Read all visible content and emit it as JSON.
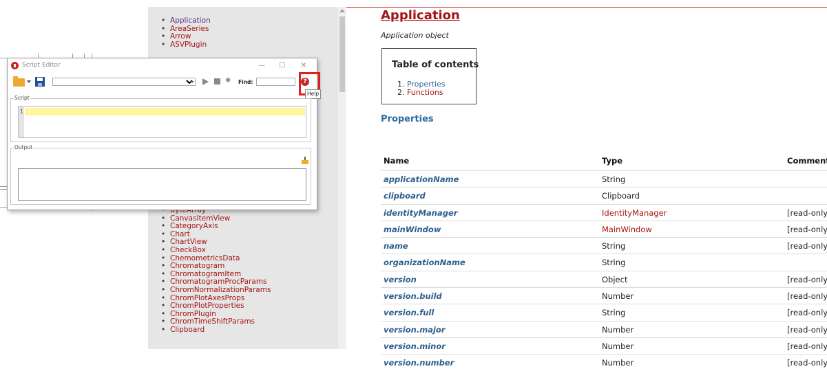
{
  "nav": {
    "top_items": [
      {
        "label": "Application",
        "visited": true
      },
      {
        "label": "AreaSeries",
        "visited": false
      },
      {
        "label": "Arrow",
        "visited": false
      },
      {
        "label": "ASVPlugin",
        "visited": false
      }
    ],
    "bottom_items": [
      {
        "label": "ByteArray",
        "visited": false
      },
      {
        "label": "CanvasItemView",
        "visited": false
      },
      {
        "label": "CategoryAxis",
        "visited": false
      },
      {
        "label": "Chart",
        "visited": false
      },
      {
        "label": "ChartView",
        "visited": false
      },
      {
        "label": "CheckBox",
        "visited": false
      },
      {
        "label": "ChemometricsData",
        "visited": false
      },
      {
        "label": "Chromatogram",
        "visited": false
      },
      {
        "label": "ChromatogramItem",
        "visited": false
      },
      {
        "label": "ChromatogramProcParams",
        "visited": false
      },
      {
        "label": "ChromNormalizationParams",
        "visited": false
      },
      {
        "label": "ChromPlotAxesProps",
        "visited": false
      },
      {
        "label": "ChromPlotProperties",
        "visited": false
      },
      {
        "label": "ChromPlugin",
        "visited": false
      },
      {
        "label": "ChromTimeShiftParams",
        "visited": false
      },
      {
        "label": "Clipboard",
        "visited": false
      }
    ]
  },
  "doc": {
    "title": "Application",
    "subtitle": "Application object",
    "toc": {
      "title": "Table of contents",
      "items": [
        "Properties",
        "Functions"
      ]
    },
    "properties_heading": "Properties",
    "table": {
      "headers": {
        "name": "Name",
        "type": "Type",
        "comments": "Comments"
      },
      "rows": [
        {
          "name": "applicationName",
          "type": "String",
          "type_link": false,
          "comments": ""
        },
        {
          "name": "clipboard",
          "type": "Clipboard",
          "type_link": false,
          "comments": ""
        },
        {
          "name": "identityManager",
          "type": "IdentityManager",
          "type_link": true,
          "comments": "[read-only]"
        },
        {
          "name": "mainWindow",
          "type": "MainWindow",
          "type_link": true,
          "comments": "[read-only]"
        },
        {
          "name": "name",
          "type": "String",
          "type_link": false,
          "comments": "[read-only]"
        },
        {
          "name": "organizationName",
          "type": "String",
          "type_link": false,
          "comments": ""
        },
        {
          "name": "version",
          "type": "Object",
          "type_link": false,
          "comments": "[read-only]"
        },
        {
          "name": "version.build",
          "type": "Number",
          "type_link": false,
          "comments": "[read-only]"
        },
        {
          "name": "version.full",
          "type": "String",
          "type_link": false,
          "comments": "[read-only]"
        },
        {
          "name": "version.major",
          "type": "Number",
          "type_link": false,
          "comments": "[read-only]"
        },
        {
          "name": "version.minor",
          "type": "Number",
          "type_link": false,
          "comments": "[read-only]"
        },
        {
          "name": "version.number",
          "type": "Number",
          "type_link": false,
          "comments": "[read-only]"
        }
      ]
    }
  },
  "dialog": {
    "title": "Script Editor",
    "find_label": "Find:",
    "help_tooltip": "Help",
    "help_glyph": "?",
    "script_group_label": "Script",
    "output_group_label": "Output",
    "line_number": "1",
    "window_buttons": {
      "minimize": "—",
      "maximize": "☐",
      "close": "✕"
    }
  },
  "colors": {
    "link": "#a31515",
    "visited_link": "#5a2d82",
    "property_name": "#2e5e8e",
    "heading_blue": "#2e6b9e",
    "highlight_red": "#e02020",
    "current_line": "#fff59d"
  }
}
